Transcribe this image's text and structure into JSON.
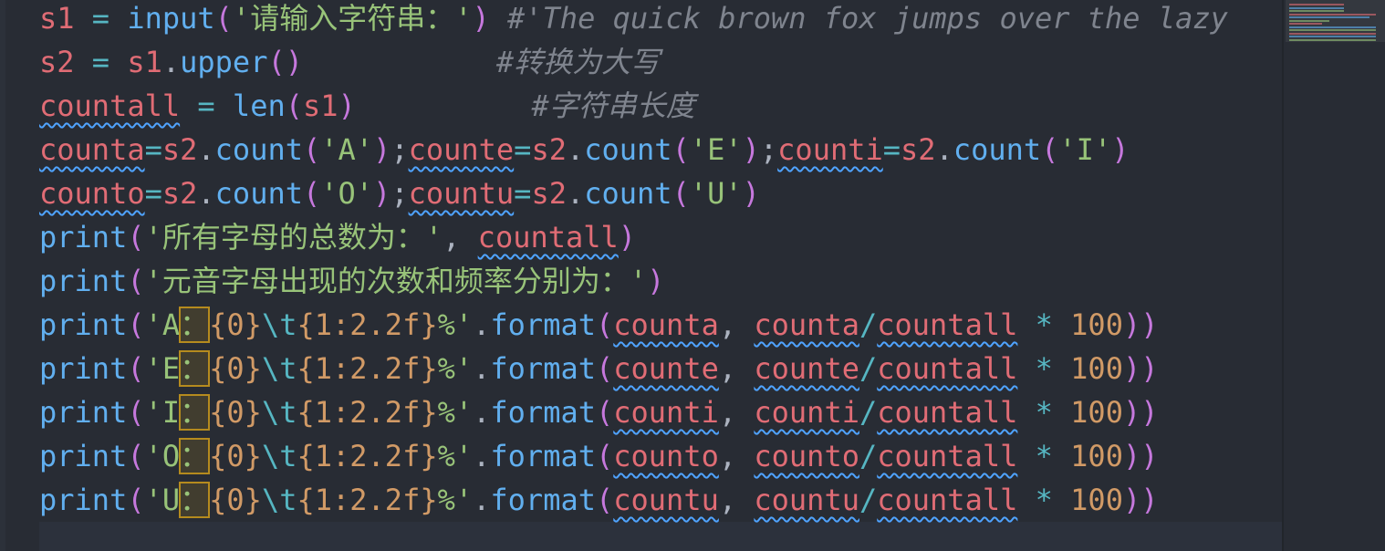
{
  "editor": {
    "language": "python",
    "lines": [
      {
        "tokens": [
          {
            "t": "s1",
            "k": "v"
          },
          {
            "t": " ",
            "k": "p"
          },
          {
            "t": "=",
            "k": "o"
          },
          {
            "t": " ",
            "k": "p"
          },
          {
            "t": "input",
            "k": "f"
          },
          {
            "t": "(",
            "k": "b"
          },
          {
            "t": "'请输入字符串：'",
            "k": "s"
          },
          {
            "t": ")",
            "k": "b"
          },
          {
            "t": " ",
            "k": "p"
          },
          {
            "t": "#'The quick brown fox jumps over the lazy",
            "k": "c"
          }
        ]
      },
      {
        "tokens": [
          {
            "t": "s2",
            "k": "v"
          },
          {
            "t": " ",
            "k": "p"
          },
          {
            "t": "=",
            "k": "o"
          },
          {
            "t": " ",
            "k": "p"
          },
          {
            "t": "s1",
            "k": "v"
          },
          {
            "t": ".",
            "k": "p"
          },
          {
            "t": "upper",
            "k": "f"
          },
          {
            "t": "()",
            "k": "b"
          },
          {
            "t": "           ",
            "k": "p"
          },
          {
            "t": "#转换为大写",
            "k": "c"
          }
        ]
      },
      {
        "tokens": [
          {
            "t": "countall",
            "k": "v",
            "sq": true
          },
          {
            "t": " ",
            "k": "p"
          },
          {
            "t": "=",
            "k": "o"
          },
          {
            "t": " ",
            "k": "p"
          },
          {
            "t": "len",
            "k": "f"
          },
          {
            "t": "(",
            "k": "b"
          },
          {
            "t": "s1",
            "k": "v"
          },
          {
            "t": ")",
            "k": "b"
          },
          {
            "t": "          ",
            "k": "p"
          },
          {
            "t": "#字符串长度",
            "k": "c"
          }
        ]
      },
      {
        "tokens": [
          {
            "t": "counta",
            "k": "v",
            "sq": true
          },
          {
            "t": "=",
            "k": "o"
          },
          {
            "t": "s2",
            "k": "v"
          },
          {
            "t": ".",
            "k": "p"
          },
          {
            "t": "count",
            "k": "f"
          },
          {
            "t": "(",
            "k": "b"
          },
          {
            "t": "'A'",
            "k": "s"
          },
          {
            "t": ")",
            "k": "b"
          },
          {
            "t": ";",
            "k": "p"
          },
          {
            "t": "counte",
            "k": "v",
            "sq": true
          },
          {
            "t": "=",
            "k": "o"
          },
          {
            "t": "s2",
            "k": "v"
          },
          {
            "t": ".",
            "k": "p"
          },
          {
            "t": "count",
            "k": "f"
          },
          {
            "t": "(",
            "k": "b"
          },
          {
            "t": "'E'",
            "k": "s"
          },
          {
            "t": ")",
            "k": "b"
          },
          {
            "t": ";",
            "k": "p"
          },
          {
            "t": "counti",
            "k": "v",
            "sq": true
          },
          {
            "t": "=",
            "k": "o"
          },
          {
            "t": "s2",
            "k": "v"
          },
          {
            "t": ".",
            "k": "p"
          },
          {
            "t": "count",
            "k": "f"
          },
          {
            "t": "(",
            "k": "b"
          },
          {
            "t": "'I'",
            "k": "s"
          },
          {
            "t": ")",
            "k": "b"
          }
        ]
      },
      {
        "tokens": [
          {
            "t": "counto",
            "k": "v",
            "sq": true
          },
          {
            "t": "=",
            "k": "o"
          },
          {
            "t": "s2",
            "k": "v"
          },
          {
            "t": ".",
            "k": "p"
          },
          {
            "t": "count",
            "k": "f"
          },
          {
            "t": "(",
            "k": "b"
          },
          {
            "t": "'O'",
            "k": "s"
          },
          {
            "t": ")",
            "k": "b"
          },
          {
            "t": ";",
            "k": "p"
          },
          {
            "t": "countu",
            "k": "v",
            "sq": true
          },
          {
            "t": "=",
            "k": "o"
          },
          {
            "t": "s2",
            "k": "v"
          },
          {
            "t": ".",
            "k": "p"
          },
          {
            "t": "count",
            "k": "f"
          },
          {
            "t": "(",
            "k": "b"
          },
          {
            "t": "'U'",
            "k": "s"
          },
          {
            "t": ")",
            "k": "b"
          }
        ]
      },
      {
        "tokens": [
          {
            "t": "print",
            "k": "f"
          },
          {
            "t": "(",
            "k": "b"
          },
          {
            "t": "'所有字母的总数为：'",
            "k": "s"
          },
          {
            "t": ", ",
            "k": "p"
          },
          {
            "t": "countall",
            "k": "v",
            "sq": true
          },
          {
            "t": ")",
            "k": "b"
          }
        ]
      },
      {
        "tokens": [
          {
            "t": "print",
            "k": "f"
          },
          {
            "t": "(",
            "k": "b"
          },
          {
            "t": "'元音字母出现的次数和频率分别为：'",
            "k": "s"
          },
          {
            "t": ")",
            "k": "b"
          }
        ]
      },
      {
        "tokens": [
          {
            "t": "print",
            "k": "f"
          },
          {
            "t": "(",
            "k": "b"
          },
          {
            "t": "'A",
            "k": "s"
          },
          {
            "t": "：",
            "k": "s",
            "hl": true
          },
          {
            "t": "{0}",
            "k": "bi"
          },
          {
            "t": "\\t",
            "k": "esc"
          },
          {
            "t": "{1:2.2f}",
            "k": "bi"
          },
          {
            "t": "%'",
            "k": "s"
          },
          {
            "t": ".",
            "k": "p"
          },
          {
            "t": "format",
            "k": "f"
          },
          {
            "t": "(",
            "k": "b"
          },
          {
            "t": "counta",
            "k": "v",
            "sq": true
          },
          {
            "t": ", ",
            "k": "p"
          },
          {
            "t": "counta",
            "k": "v",
            "sq": true
          },
          {
            "t": "/",
            "k": "o"
          },
          {
            "t": "countall",
            "k": "v",
            "sq": true
          },
          {
            "t": " ",
            "k": "p"
          },
          {
            "t": "*",
            "k": "o"
          },
          {
            "t": " ",
            "k": "p"
          },
          {
            "t": "100",
            "k": "n"
          },
          {
            "t": "))",
            "k": "b"
          }
        ]
      },
      {
        "tokens": [
          {
            "t": "print",
            "k": "f"
          },
          {
            "t": "(",
            "k": "b"
          },
          {
            "t": "'E",
            "k": "s"
          },
          {
            "t": "：",
            "k": "s",
            "hl": true
          },
          {
            "t": "{0}",
            "k": "bi"
          },
          {
            "t": "\\t",
            "k": "esc"
          },
          {
            "t": "{1:2.2f}",
            "k": "bi"
          },
          {
            "t": "%'",
            "k": "s"
          },
          {
            "t": ".",
            "k": "p"
          },
          {
            "t": "format",
            "k": "f"
          },
          {
            "t": "(",
            "k": "b"
          },
          {
            "t": "counte",
            "k": "v",
            "sq": true
          },
          {
            "t": ", ",
            "k": "p"
          },
          {
            "t": "counte",
            "k": "v",
            "sq": true
          },
          {
            "t": "/",
            "k": "o"
          },
          {
            "t": "countall",
            "k": "v",
            "sq": true
          },
          {
            "t": " ",
            "k": "p"
          },
          {
            "t": "*",
            "k": "o"
          },
          {
            "t": " ",
            "k": "p"
          },
          {
            "t": "100",
            "k": "n"
          },
          {
            "t": "))",
            "k": "b"
          }
        ]
      },
      {
        "tokens": [
          {
            "t": "print",
            "k": "f"
          },
          {
            "t": "(",
            "k": "b"
          },
          {
            "t": "'I",
            "k": "s"
          },
          {
            "t": "：",
            "k": "s",
            "hl": true
          },
          {
            "t": "{0}",
            "k": "bi"
          },
          {
            "t": "\\t",
            "k": "esc"
          },
          {
            "t": "{1:2.2f}",
            "k": "bi"
          },
          {
            "t": "%'",
            "k": "s"
          },
          {
            "t": ".",
            "k": "p"
          },
          {
            "t": "format",
            "k": "f"
          },
          {
            "t": "(",
            "k": "b"
          },
          {
            "t": "counti",
            "k": "v",
            "sq": true
          },
          {
            "t": ", ",
            "k": "p"
          },
          {
            "t": "counti",
            "k": "v",
            "sq": true
          },
          {
            "t": "/",
            "k": "o"
          },
          {
            "t": "countall",
            "k": "v",
            "sq": true
          },
          {
            "t": " ",
            "k": "p"
          },
          {
            "t": "*",
            "k": "o"
          },
          {
            "t": " ",
            "k": "p"
          },
          {
            "t": "100",
            "k": "n"
          },
          {
            "t": "))",
            "k": "b"
          }
        ]
      },
      {
        "tokens": [
          {
            "t": "print",
            "k": "f"
          },
          {
            "t": "(",
            "k": "b"
          },
          {
            "t": "'O",
            "k": "s"
          },
          {
            "t": "：",
            "k": "s",
            "hl": true
          },
          {
            "t": "{0}",
            "k": "bi"
          },
          {
            "t": "\\t",
            "k": "esc"
          },
          {
            "t": "{1:2.2f}",
            "k": "bi"
          },
          {
            "t": "%'",
            "k": "s"
          },
          {
            "t": ".",
            "k": "p"
          },
          {
            "t": "format",
            "k": "f"
          },
          {
            "t": "(",
            "k": "b"
          },
          {
            "t": "counto",
            "k": "v",
            "sq": true
          },
          {
            "t": ", ",
            "k": "p"
          },
          {
            "t": "counto",
            "k": "v",
            "sq": true
          },
          {
            "t": "/",
            "k": "o"
          },
          {
            "t": "countall",
            "k": "v",
            "sq": true
          },
          {
            "t": " ",
            "k": "p"
          },
          {
            "t": "*",
            "k": "o"
          },
          {
            "t": " ",
            "k": "p"
          },
          {
            "t": "100",
            "k": "n"
          },
          {
            "t": "))",
            "k": "b"
          }
        ]
      },
      {
        "tokens": [
          {
            "t": "print",
            "k": "f"
          },
          {
            "t": "(",
            "k": "b"
          },
          {
            "t": "'U",
            "k": "s"
          },
          {
            "t": "：",
            "k": "s",
            "hl": true
          },
          {
            "t": "{0}",
            "k": "bi"
          },
          {
            "t": "\\t",
            "k": "esc"
          },
          {
            "t": "{1:2.2f}",
            "k": "bi"
          },
          {
            "t": "%'",
            "k": "s"
          },
          {
            "t": ".",
            "k": "p"
          },
          {
            "t": "format",
            "k": "f"
          },
          {
            "t": "(",
            "k": "b"
          },
          {
            "t": "countu",
            "k": "v",
            "sq": true
          },
          {
            "t": ", ",
            "k": "p"
          },
          {
            "t": "countu",
            "k": "v",
            "sq": true
          },
          {
            "t": "/",
            "k": "o"
          },
          {
            "t": "countall",
            "k": "v",
            "sq": true
          },
          {
            "t": " ",
            "k": "p"
          },
          {
            "t": "*",
            "k": "o"
          },
          {
            "t": " ",
            "k": "p"
          },
          {
            "t": "100",
            "k": "n"
          },
          {
            "t": "))",
            "k": "b"
          }
        ]
      }
    ]
  },
  "theme": {
    "background": "#282c34",
    "variable": "#e06c75",
    "function": "#61afef",
    "string": "#98c379",
    "comment": "#7f848e",
    "number": "#d19a66",
    "operator": "#56b6c2",
    "squiggle": "#4fa3ff",
    "highlight_box": "#b58b1e"
  }
}
